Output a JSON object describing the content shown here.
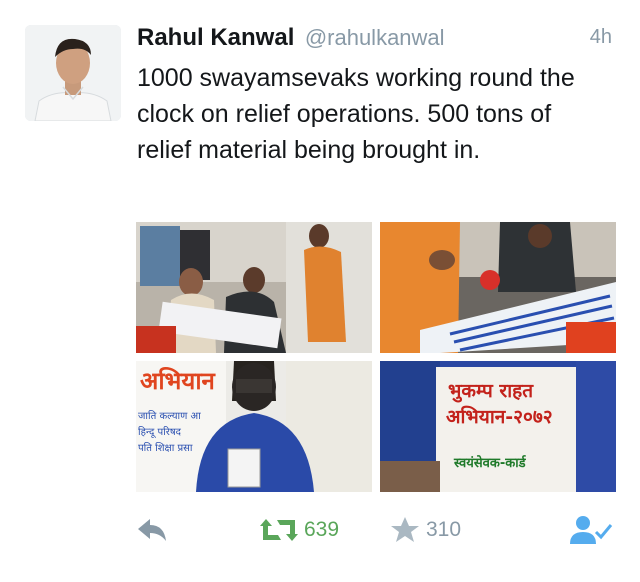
{
  "tweet": {
    "display_name": "Rahul Kanwal",
    "handle": "@rahulkanwal",
    "time": "4h",
    "text": "1000 swayamsevaks working round the clock on relief operations. 500 tons of relief material being brought in.",
    "media": {
      "photo3_banner_text": "अभियान",
      "photo3_lines": [
        "जाति कल्याण आ",
        "हिन्दू परिषद",
        "पति शिक्षा प्रसा"
      ],
      "photo4_card_title": "भुकम्प राहत",
      "photo4_card_subtitle": "अभियान-२०७२",
      "photo4_card_footer": "स्वयंसेवक-कार्ड"
    },
    "actions": {
      "retweet_count": "639",
      "favorite_count": "310"
    }
  },
  "colors": {
    "retweet": "#5aa65a",
    "follow": "#55acee",
    "muted": "#8899a6"
  }
}
